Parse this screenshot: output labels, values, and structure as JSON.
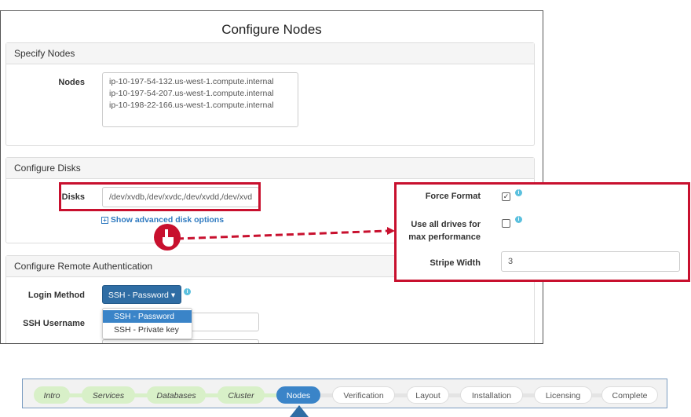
{
  "window": {
    "title": "Configure Nodes"
  },
  "specify_nodes": {
    "header": "Specify Nodes",
    "nodes_label": "Nodes",
    "nodes": [
      "ip-10-197-54-132.us-west-1.compute.internal",
      "ip-10-197-54-207.us-west-1.compute.internal",
      "ip-10-198-22-166.us-west-1.compute.internal"
    ]
  },
  "configure_disks": {
    "header": "Configure Disks",
    "disks_label": "Disks",
    "disks_value": "/dev/xvdb,/dev/xvdc,/dev/xvdd,/dev/xvd",
    "advanced_link": "Show advanced disk options",
    "advanced_icon": "plus-square-icon"
  },
  "remote_auth": {
    "header": "Configure Remote Authentication",
    "login_label": "Login Method",
    "login_value": "SSH - Password",
    "username_label": "SSH Username",
    "options": [
      "SSH - Password",
      "SSH - Private key"
    ]
  },
  "advanced": {
    "force_format_label": "Force Format",
    "force_format_checked": true,
    "use_all_label_1": "Use all drives for",
    "use_all_label_2": "max performance",
    "use_all_checked": false,
    "stripe_label": "Stripe Width",
    "stripe_value": "3"
  },
  "wizard": {
    "steps": [
      "Intro",
      "Services",
      "Databases",
      "Cluster",
      "Nodes",
      "Verification",
      "Layout",
      "Installation",
      "Licensing",
      "Complete"
    ],
    "current": "Nodes"
  },
  "colors": {
    "highlight": "#c8102e",
    "primary": "#3a84c8",
    "done": "#d8f0c8"
  }
}
